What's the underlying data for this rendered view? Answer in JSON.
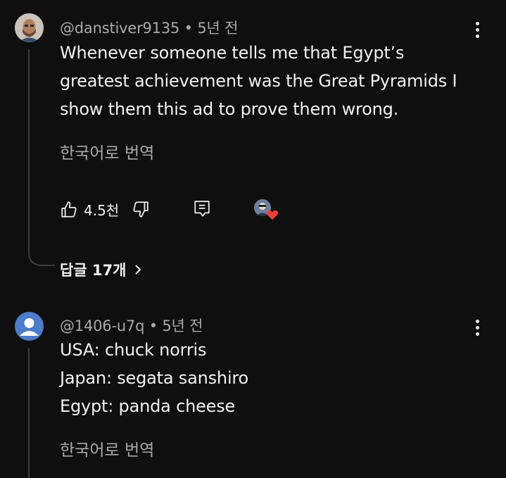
{
  "comments": [
    {
      "author": "@danstiver9135",
      "time": "5년 전",
      "text_lines": [
        "Whenever someone tells me that Egypt’s",
        "greatest achievement was the Great Pyramids I",
        "show them this ad to prove them wrong."
      ],
      "translate_label": "한국어로 번역",
      "like_count": "4.5천",
      "replies_label": "답글 17개",
      "avatar_icon": "user-photo-avatar"
    },
    {
      "author": "@1406-u7q",
      "time": "5년 전",
      "text_lines": [
        "USA: chuck norris",
        "Japan: segata sanshiro",
        "Egypt: panda cheese"
      ],
      "translate_label": "한국어로 번역",
      "avatar_icon": "default-person-avatar"
    }
  ],
  "separator": "•",
  "colors": {
    "background": "#0f0f0f",
    "text": "#f1f1f1",
    "muted": "#aaaaaa",
    "avatar_blue": "#4d7cc9",
    "heart_red": "#f03e3e"
  }
}
